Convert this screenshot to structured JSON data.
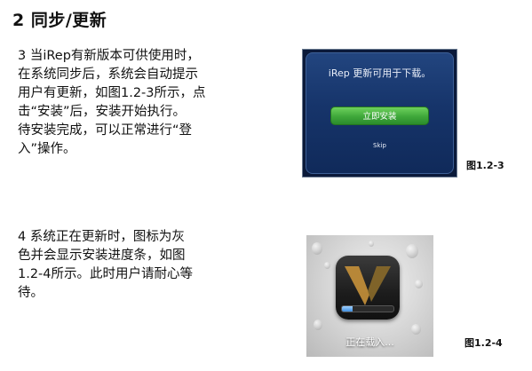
{
  "heading": "2 同步/更新",
  "paragraph1": {
    "lines": [
      "3 当iRep有新版本可供使用时，",
      "在系统同步后，系统会自动提示",
      "用户有更新，如图1.2-3所示，点",
      "击“安装”后，安装开始执行。",
      "待安装完成，可以正常进行“登",
      "入”操作。"
    ]
  },
  "paragraph2": {
    "lines": [
      "4 系统正在更新时，图标为灰",
      "色并会显示安装进度条，如图",
      "1.2-4所示。此时用户请耐心等",
      "待。"
    ]
  },
  "figure1": {
    "dialog_title": "iRep 更新可用于下载。",
    "install_button": "立即安装",
    "skip_link": "Skip",
    "caption": "图1.2-3",
    "colors": {
      "dialog_bg": "#16346a",
      "button": "#3ea73a"
    }
  },
  "figure2": {
    "icon": "irep-app-icon",
    "loading_text": "正在载入...",
    "progress": 0.2,
    "caption": "图1.2-4"
  }
}
